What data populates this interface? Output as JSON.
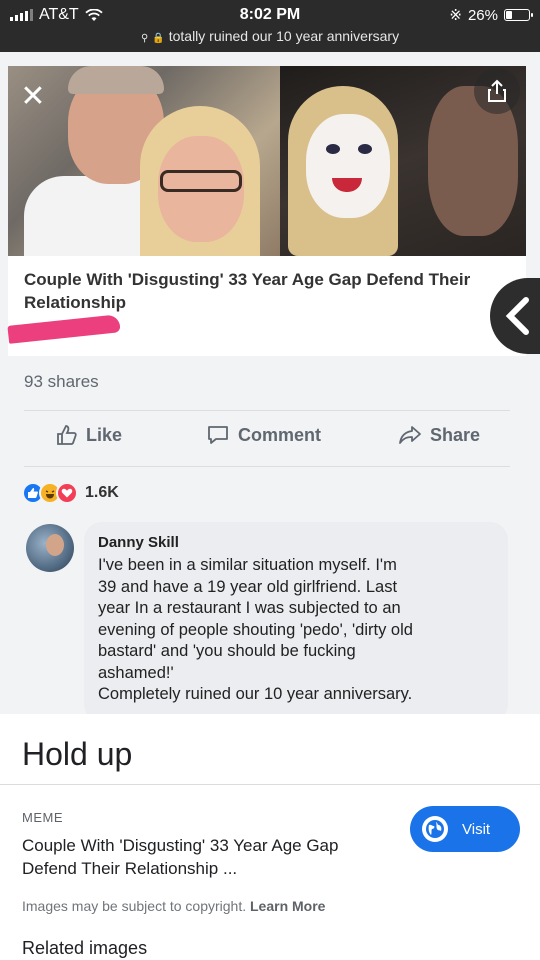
{
  "status_bar": {
    "carrier": "AT&T",
    "time": "8:02 PM",
    "battery": "26%",
    "battery_level": 0.26,
    "url": "totally ruined our 10 year anniversary",
    "icons": [
      "signal-icon",
      "wifi-icon",
      "search-icon",
      "lock-icon",
      "bluetooth-icon",
      "battery-icon"
    ]
  },
  "screenshot": {
    "article_title": "Couple With 'Disgusting' 33 Year Age Gap Defend Their Relationship",
    "shares": "93 shares",
    "actions": {
      "like": "Like",
      "comment": "Comment",
      "share": "Share"
    },
    "reaction_count": "1.6K",
    "reaction_icons": [
      "like-reaction-icon",
      "haha-reaction-icon",
      "love-reaction-icon"
    ],
    "comment": {
      "author": "Danny Skill",
      "text": "I've been in a similar situation  myself. I'm\n39 and have a 19 year old girlfriend. Last\nyear In a restaurant I was subjected to an\nevening of people shouting 'pedo', 'dirty old\nbastard' and 'you should be fucking\nashamed!'\nCompletely ruined our 10 year anniversary."
    }
  },
  "panel": {
    "title": "Hold up",
    "source": "MEME",
    "result_title": "Couple With 'Disgusting' 33 Year Age Gap Defend Their Relationship ...",
    "visit_label": "Visit",
    "copyright": "Images may be subject to copyright.",
    "learn_more": "Learn More",
    "related": "Related images"
  },
  "colors": {
    "accent_blue": "#1a73e8",
    "facebook_blue": "#1877f2",
    "highlight_pink": "#ec3f7e"
  }
}
